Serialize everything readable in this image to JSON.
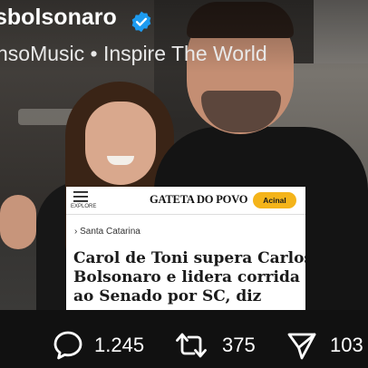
{
  "post": {
    "username": "sbolsonaro",
    "tagline": "nsoMusic • Inspire The World",
    "verified_color": "#1d9bf0"
  },
  "news_card": {
    "menu_label": "EXPLORE",
    "masthead": "GATETA DO POVO",
    "subscribe_label": "Acinal",
    "breadcrumb": "› Santa Catarina",
    "headline_lines": [
      "Carol de Toni supera Carlos",
      "Bolsonaro e lidera corrida",
      "ao Senado por SC, diz"
    ],
    "accent_color": "#f4b41a"
  },
  "actions": {
    "replies": {
      "icon": "reply-icon",
      "count": "1.245"
    },
    "reposts": {
      "icon": "repost-icon",
      "count": "375"
    },
    "shares": {
      "icon": "share-icon",
      "count": "103"
    }
  }
}
